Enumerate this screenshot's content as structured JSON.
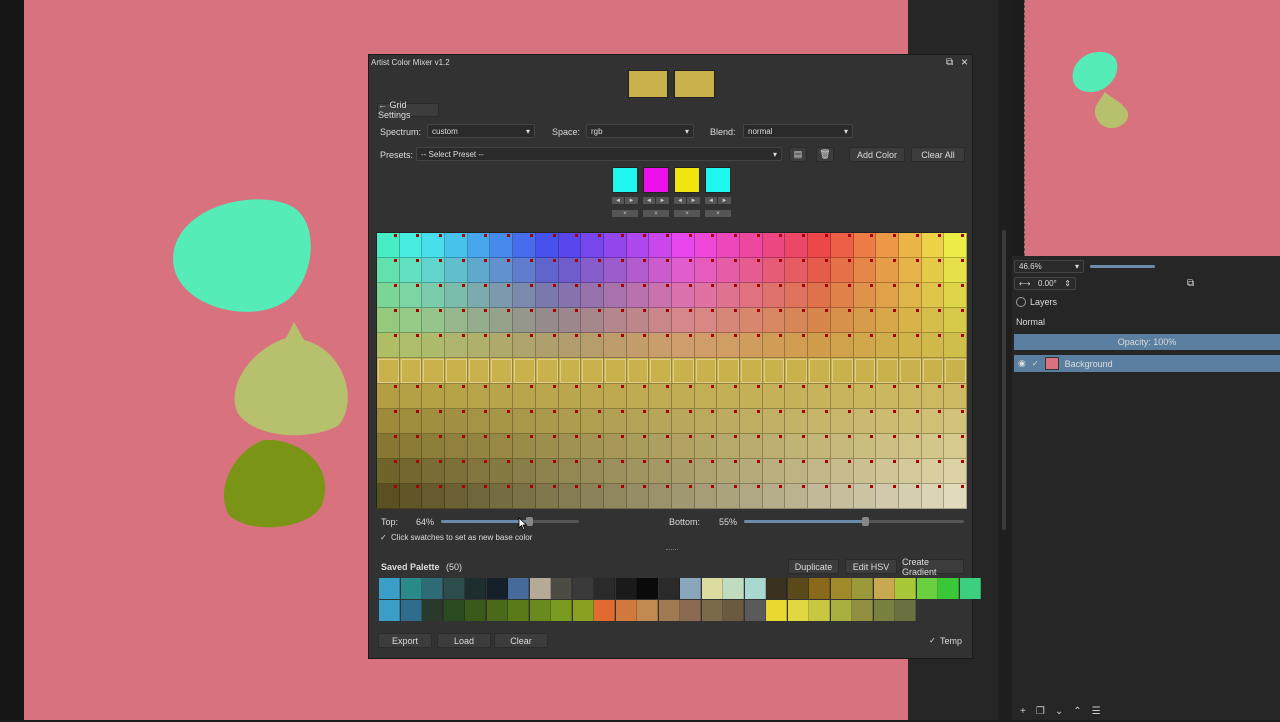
{
  "dialog": {
    "title": "Artist Color Mixer v1.2",
    "current_color": "#c9b24c",
    "previous_color": "#c9b24c",
    "grid_settings_label": "← Grid Settings",
    "spectrum_label": "Spectrum:",
    "spectrum_value": "custom",
    "space_label": "Space:",
    "space_value": "rgb",
    "blend_label": "Blend:",
    "blend_value": "normal",
    "presets_label": "Presets:",
    "presets_value": "-- Select Preset --",
    "add_color_label": "Add Color",
    "clear_all_label": "Clear All",
    "gradient_colors": [
      "#1ef6f0",
      "#ee10ea",
      "#f0e60e",
      "#1ef6f0"
    ],
    "arrow_left": "◄",
    "arrow_right": "►",
    "remove_glyph": "×",
    "top_label": "Top:",
    "top_value": "64%",
    "top_fraction": 0.64,
    "bottom_label": "Bottom:",
    "bottom_value": "55%",
    "bottom_fraction": 0.55,
    "click_swatch_label": "Click swatches to set as new base color",
    "check_glyph": "✓",
    "saved_palette_label": "Saved Palette",
    "saved_palette_count": "(50)",
    "duplicate_label": "Duplicate",
    "edit_hsv_label": "Edit HSV",
    "create_gradient_label": "Create Gradient",
    "export_label": "Export",
    "load_label": "Load",
    "clear_label": "Clear",
    "temp_label": "Temp",
    "palette_row1": [
      "#3a9ec8",
      "#2a8a8a",
      "#2f6b74",
      "#2d4c4c",
      "#1e2e2e",
      "#16202a",
      "#466a9a",
      "#b4aa96",
      "#4c4c44",
      "#3a3a3a",
      "#2a2a2a",
      "#1a1a1a",
      "#0a0a0a",
      "#2a2a2a",
      "#8aa6ba",
      "#dcdca0",
      "#c0dcc0",
      "#a8d8d0",
      "#3a3020",
      "#5a4a1a",
      "#8a6a1a",
      "#a08a2a",
      "#9a9a3a",
      "#c8a850",
      "#a8c838",
      "#6ad040",
      "#3ac838",
      "#3ad080"
    ],
    "palette_row2": [
      "#3a9ec8",
      "#2f6b8a",
      "#2a3a2a",
      "#2a4a20",
      "#3a5a1a",
      "#4a6a1a",
      "#5a7a1a",
      "#6a8a20",
      "#7a9a20",
      "#8aa020",
      "#e06a30",
      "#d07a40",
      "#c08a50",
      "#a07a50",
      "#8a6a50",
      "#7a6a4a",
      "#6a5a40",
      "#5a5a5a",
      "#e8d830",
      "#e0d840",
      "#c8c840",
      "#a8b040",
      "#909040",
      "#7a8040",
      "#6a7040"
    ]
  },
  "right_panel": {
    "zoom_value": "46.6%",
    "rotation_value": "0.00°",
    "layers_title": "Layers",
    "blend_mode": "Normal",
    "opacity_label": "Opacity:  100%",
    "layer_name": "Background"
  },
  "colors": {
    "canvas_bg": "#d8727e",
    "accent": "#5a7fa0",
    "shape_cyan": "#55ecb7",
    "shape_khaki": "#b7c06c",
    "shape_olive": "#7a9516"
  }
}
